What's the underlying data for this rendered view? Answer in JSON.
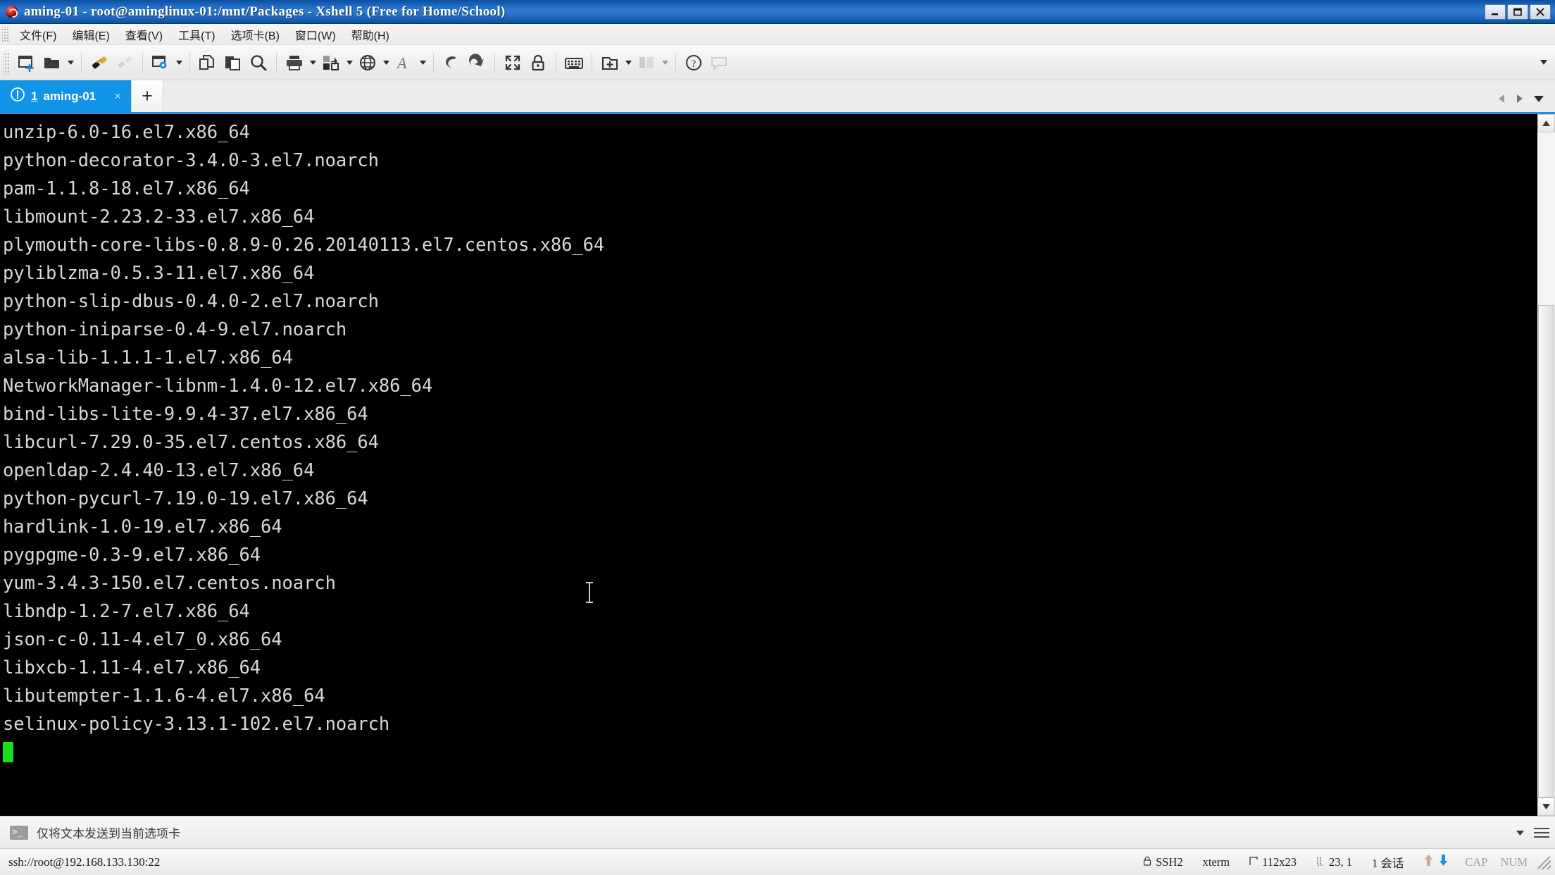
{
  "window": {
    "title": "aming-01 - root@aminglinux-01:/mnt/Packages - Xshell 5 (Free for Home/School)",
    "app_icon": "xshell-icon",
    "controls": {
      "minimize": "minimize-icon",
      "maximize": "maximize-icon",
      "close": "close-icon"
    }
  },
  "menubar": {
    "items": [
      {
        "label": "文件(F)",
        "name": "menu-file"
      },
      {
        "label": "编辑(E)",
        "name": "menu-edit"
      },
      {
        "label": "查看(V)",
        "name": "menu-view"
      },
      {
        "label": "工具(T)",
        "name": "menu-tools"
      },
      {
        "label": "选项卡(B)",
        "name": "menu-tabs"
      },
      {
        "label": "窗口(W)",
        "name": "menu-window"
      },
      {
        "label": "帮助(H)",
        "name": "menu-help"
      }
    ]
  },
  "toolbar": {
    "buttons": [
      {
        "name": "new-session-icon",
        "title": "新建会话"
      },
      {
        "name": "open-folder-icon",
        "title": "打开"
      },
      {
        "name": "connect-icon",
        "title": "连接"
      },
      {
        "name": "disconnect-icon",
        "title": "断开"
      },
      {
        "name": "session-properties-icon",
        "title": "属性"
      },
      {
        "name": "copy-icon",
        "title": "复制"
      },
      {
        "name": "paste-icon",
        "title": "粘贴"
      },
      {
        "name": "find-icon",
        "title": "查找"
      },
      {
        "name": "print-icon",
        "title": "打印"
      },
      {
        "name": "file-transfer-icon",
        "title": "传输"
      },
      {
        "name": "web-browser-icon",
        "title": "浏览器"
      },
      {
        "name": "font-icon",
        "title": "字体"
      },
      {
        "name": "compose-bar-icon",
        "title": "撰写栏"
      },
      {
        "name": "quick-command-icon",
        "title": "快速命令"
      },
      {
        "name": "fullscreen-icon",
        "title": "全屏"
      },
      {
        "name": "lock-icon",
        "title": "锁定"
      },
      {
        "name": "keyboard-icon",
        "title": "键盘"
      },
      {
        "name": "new-folder-icon",
        "title": "新建文件夹"
      },
      {
        "name": "layout-icon",
        "title": "布局"
      },
      {
        "name": "help-icon",
        "title": "帮助"
      },
      {
        "name": "chat-icon",
        "title": "聊天"
      }
    ],
    "overflow": "toolbar-overflow-icon"
  },
  "tabs": {
    "items": [
      {
        "index": "1",
        "label": "aming-01",
        "status_icon": "warning-icon",
        "close": "×",
        "active": true
      }
    ],
    "new_tab_label": "+",
    "nav": {
      "prev": "prev-tab-icon",
      "next": "next-tab-icon",
      "list": "tab-list-icon"
    }
  },
  "terminal": {
    "lines": [
      "unzip-6.0-16.el7.x86_64",
      "python-decorator-3.4.0-3.el7.noarch",
      "pam-1.1.8-18.el7.x86_64",
      "libmount-2.23.2-33.el7.x86_64",
      "plymouth-core-libs-0.8.9-0.26.20140113.el7.centos.x86_64",
      "pyliblzma-0.5.3-11.el7.x86_64",
      "python-slip-dbus-0.4.0-2.el7.noarch",
      "python-iniparse-0.4-9.el7.noarch",
      "alsa-lib-1.1.1-1.el7.x86_64",
      "NetworkManager-libnm-1.4.0-12.el7.x86_64",
      "bind-libs-lite-9.9.4-37.el7.x86_64",
      "libcurl-7.29.0-35.el7.centos.x86_64",
      "openldap-2.4.40-13.el7.x86_64",
      "python-pycurl-7.19.0-19.el7.x86_64",
      "hardlink-1.0-19.el7.x86_64",
      "pygpgme-0.3-9.el7.x86_64",
      "yum-3.4.3-150.el7.centos.noarch",
      "libndp-1.2-7.el7.x86_64",
      "json-c-0.11-4.el7_0.x86_64",
      "libxcb-1.11-4.el7.x86_64",
      "libutempter-1.1.6-4.el7.x86_64",
      "selinux-policy-3.13.1-102.el7.noarch"
    ],
    "cursor": "block-cursor",
    "colors": {
      "background": "#000000",
      "foreground": "#d8d8d8",
      "cursor": "#18e018"
    }
  },
  "scrollbar": {
    "up": "scroll-up-icon",
    "down": "scroll-down-icon",
    "thumb": "scroll-thumb"
  },
  "sendbar": {
    "icon": "terminal-prompt-icon",
    "text": "仅将文本发送到当前选项卡",
    "caret": "chevron-down-icon",
    "menu": "hamburger-menu-icon"
  },
  "statusbar": {
    "connection": "ssh://root@192.168.133.130:22",
    "cells": [
      {
        "name": "status-protocol",
        "icon": "lock-icon",
        "label": "SSH2"
      },
      {
        "name": "status-terminal-type",
        "icon": "",
        "label": "xterm"
      },
      {
        "name": "status-screen-size",
        "icon": "size-icon",
        "label": "112x23"
      },
      {
        "name": "status-cursor-position",
        "icon": "position-icon",
        "label": "23, 1"
      },
      {
        "name": "status-session-count",
        "icon": "",
        "label": "1 会话"
      }
    ],
    "indicators": {
      "upload": "upload-arrow-icon",
      "download": "download-arrow-icon",
      "caps": "CAP",
      "num": "NUM"
    },
    "resize_grip": "resize-grip-icon"
  },
  "colors": {
    "titlebar": "#1b63b8",
    "tab_active": "#0f94e8",
    "accent": "#1e90e0",
    "chrome": "#f0f0f0"
  }
}
